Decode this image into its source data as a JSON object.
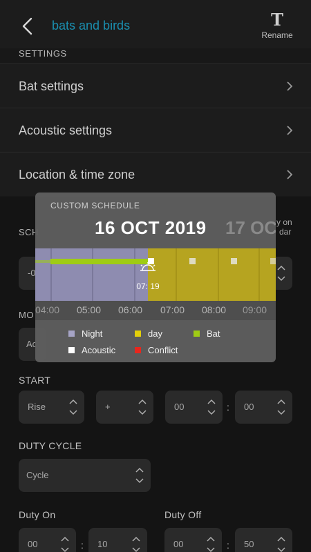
{
  "header": {
    "title": "bats and birds",
    "rename_label": "Rename",
    "rename_glyph": "T"
  },
  "settings_section": "SETTINGS",
  "settings": [
    {
      "label": "Bat settings"
    },
    {
      "label": "Acoustic settings"
    },
    {
      "label": "Location & time zone"
    }
  ],
  "peek": {
    "schedule": "SCH",
    "mode": "MO",
    "view_on_line1": "y on",
    "view_on_line2": "dar",
    "timeline_value": "-0",
    "mode_value": "Ac"
  },
  "schedule_popup": {
    "heading": "CUSTOM SCHEDULE",
    "date": "16 OCT 2019",
    "next_date": "17 OC",
    "marker_time": "07: 19",
    "ticks": [
      "04:00",
      "05:00",
      "06:00",
      "07:00",
      "08:00",
      "09:00"
    ],
    "legend": [
      {
        "label": "Night",
        "color": "#a6a4c6"
      },
      {
        "label": "day",
        "color": "#e3cf0a"
      },
      {
        "label": "Bat",
        "color": "#9fcc14"
      },
      {
        "label": "Acoustic",
        "color": "#ffffff"
      },
      {
        "label": "Conflict",
        "color": "#e8261d"
      }
    ]
  },
  "start": {
    "label": "START",
    "fields": [
      {
        "value": "Rise"
      },
      {
        "value": "+"
      },
      {
        "value": "00"
      },
      {
        "value": "00"
      }
    ],
    "separator": ":"
  },
  "duty_cycle": {
    "label": "DUTY CYCLE",
    "value": "Cycle"
  },
  "duty_on": {
    "label": "Duty On",
    "hours": "00",
    "minutes": "10",
    "separator": ":"
  },
  "duty_off": {
    "label": "Duty Off",
    "hours": "00",
    "minutes": "50",
    "separator": ":"
  },
  "colors": {
    "accent": "#1a8fb0",
    "night": "#a6a4c6",
    "day": "#e3cf0a",
    "bat": "#9fcc14"
  }
}
